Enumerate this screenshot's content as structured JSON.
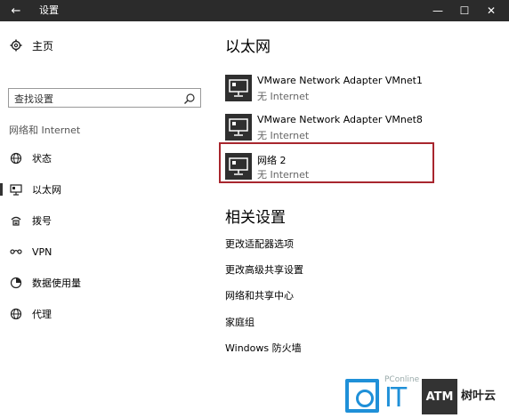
{
  "window": {
    "back_glyph": "←",
    "title": "设置",
    "minimize_glyph": "—",
    "maximize_glyph": "☐",
    "close_glyph": "✕"
  },
  "sidebar": {
    "home_label": "主页",
    "search_placeholder": "查找设置",
    "section_label": "网络和 Internet",
    "items": [
      {
        "label": "状态",
        "icon": "globe-status-icon"
      },
      {
        "label": "以太网",
        "icon": "ethernet-icon",
        "active": true
      },
      {
        "label": "拨号",
        "icon": "dialup-icon"
      },
      {
        "label": "VPN",
        "icon": "vpn-icon"
      },
      {
        "label": "数据使用量",
        "icon": "data-usage-icon"
      },
      {
        "label": "代理",
        "icon": "globe-proxy-icon"
      }
    ]
  },
  "main": {
    "title": "以太网",
    "adapters": [
      {
        "name": "VMware Network Adapter VMnet1",
        "status": "无 Internet"
      },
      {
        "name": "VMware Network Adapter VMnet8",
        "status": "无 Internet"
      },
      {
        "name": "网络  2",
        "status": "无 Internet",
        "highlighted": true
      }
    ],
    "related_title": "相关设置",
    "links": [
      "更改适配器选项",
      "更改高级共享设置",
      "网络和共享中心",
      "家庭组",
      "Windows 防火墙"
    ]
  },
  "watermark": {
    "pconline": "PConline",
    "it": "IT",
    "badge": "ATM",
    "text": "树叶云"
  },
  "colors": {
    "titlebar": "#2b2b2b",
    "highlight_border": "#a8262e",
    "watermark_blue": "#1f90d8"
  }
}
